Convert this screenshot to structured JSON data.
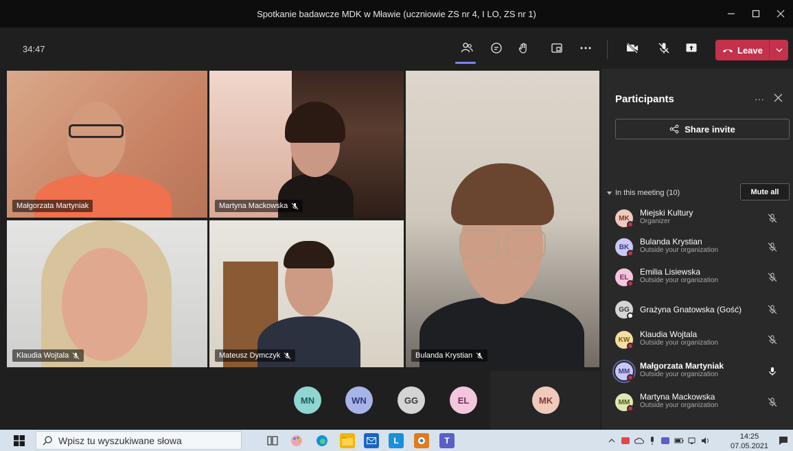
{
  "window": {
    "title": "Spotkanie badawcze MDK w Mławie (uczniowie ZS nr 4, I LO, ZS nr 1)"
  },
  "toolbar": {
    "timer": "34:47",
    "leave_label": "Leave"
  },
  "tiles": [
    {
      "name": "Małgorzata Martyniak",
      "muted": false
    },
    {
      "name": "Martyna Mackowska",
      "muted": true
    },
    {
      "name": "Bulanda Krystian",
      "muted": true
    },
    {
      "name": "Klaudia Wojtala",
      "muted": true
    },
    {
      "name": "Mateusz Dymczyk",
      "muted": true
    }
  ],
  "bottom_avatars": [
    {
      "initials": "MN",
      "color": "#8fd6d2"
    },
    {
      "initials": "WN",
      "color": "#a7b4e8"
    },
    {
      "initials": "GG",
      "color": "#d4d4d4"
    },
    {
      "initials": "EL",
      "color": "#f2c6df"
    },
    {
      "initials": "MK",
      "color": "#f0c9bd"
    }
  ],
  "participants_panel": {
    "title": "Participants",
    "share_invite": "Share invite",
    "section_label": "In this meeting (10)",
    "mute_all": "Mute all",
    "people": [
      {
        "initials": "MK",
        "name": "Miejski Kultury",
        "subtitle": "Organizer",
        "avatar_color": "#f0c9bd",
        "status": "red",
        "mic": "muted"
      },
      {
        "initials": "BK",
        "name": "Bulanda Krystian",
        "subtitle": "Outside your organization",
        "avatar_color": "#c9c8f5",
        "status": "red",
        "mic": "muted"
      },
      {
        "initials": "EL",
        "name": "Emilia Lisiewska",
        "subtitle": "Outside your organization",
        "avatar_color": "#f2c6df",
        "status": "red",
        "mic": "muted"
      },
      {
        "initials": "GG",
        "name": "Grażyna Gnatowska (Gość)",
        "subtitle": "",
        "avatar_color": "#d4d4d4",
        "status": "white",
        "mic": "muted"
      },
      {
        "initials": "KW",
        "name": "Klaudia Wojtala",
        "subtitle": "Outside your organization",
        "avatar_color": "#f5dfa0",
        "status": "red",
        "mic": "muted"
      },
      {
        "initials": "MM",
        "name": "Małgorzata Martyniak",
        "subtitle": "Outside your organization",
        "avatar_color": "#c9c8f5",
        "status": "red",
        "mic": "on"
      },
      {
        "initials": "MM",
        "name": "Martyna Mackowska",
        "subtitle": "Outside your organization",
        "avatar_color": "#dfe8b5",
        "status": "red",
        "mic": "muted"
      }
    ]
  },
  "taskbar": {
    "search_placeholder": "Wpisz tu wyszukiwane słowa",
    "time": "14:25",
    "date": "07.05.2021"
  },
  "colors": {
    "accent": "#7f85f5",
    "leave": "#c4314b",
    "panel": "#292929"
  }
}
